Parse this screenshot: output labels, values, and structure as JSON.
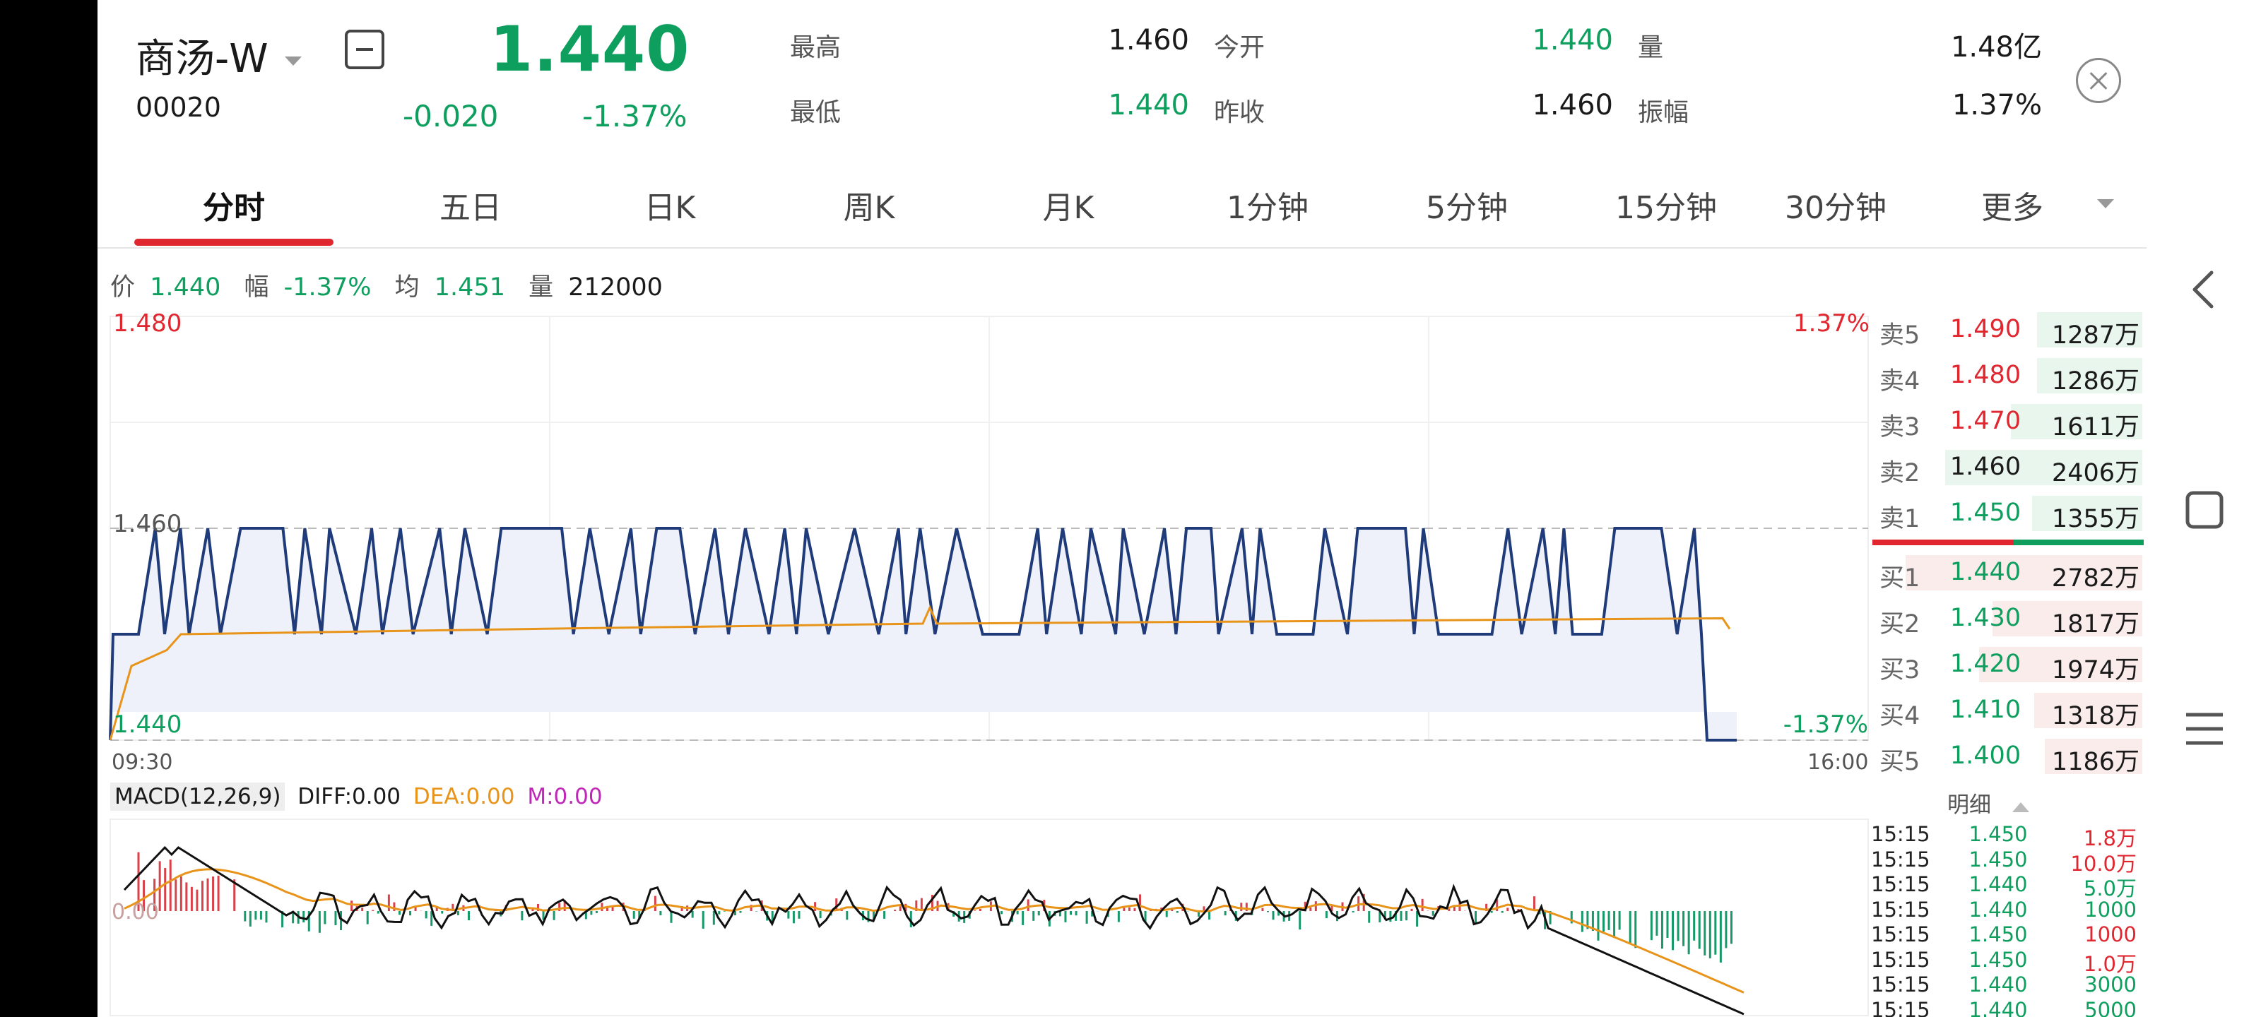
{
  "header": {
    "name": "商汤-W",
    "code": "00020",
    "price": "1.440",
    "change": "-0.020",
    "change_pct": "-1.37%",
    "quote": [
      {
        "label": "最高",
        "value": "1.460",
        "color": "#1a1a1a"
      },
      {
        "label": "今开",
        "value": "1.440",
        "color": "#0e9f5f"
      },
      {
        "label": "量",
        "value": "1.48亿",
        "color": "#1a1a1a"
      },
      {
        "label": "最低",
        "value": "1.440",
        "color": "#0e9f5f"
      },
      {
        "label": "昨收",
        "value": "1.460",
        "color": "#1a1a1a"
      },
      {
        "label": "振幅",
        "value": "1.37%",
        "color": "#1a1a1a"
      }
    ]
  },
  "tabs": [
    "分时",
    "五日",
    "日K",
    "周K",
    "月K",
    "1分钟",
    "5分钟",
    "15分钟",
    "30分钟",
    "更多"
  ],
  "info": {
    "price_label": "价",
    "price": "1.440",
    "amp_label": "幅",
    "amp": "-1.37%",
    "avg_label": "均",
    "avg": "1.451",
    "vol_label": "量",
    "vol": "212000"
  },
  "chart": {
    "y_top": "1.480",
    "y_mid": "1.460",
    "y_bottom": "1.440",
    "pct_top": "1.37%",
    "pct_bottom": "-1.37%",
    "x_start": "09:30",
    "x_end": "16:00",
    "price_range": [
      1.44,
      1.48
    ],
    "prev_close": 1.46
  },
  "chart_data": {
    "type": "line",
    "title": "",
    "xlabel": "",
    "ylabel": "",
    "x_range": [
      "09:30",
      "16:00"
    ],
    "ylim": [
      1.44,
      1.48
    ],
    "series": [
      {
        "name": "价",
        "style": "toggling",
        "low": 1.45,
        "high": 1.46,
        "final": 1.44,
        "color": "#1f3b7a"
      },
      {
        "name": "均",
        "values_summary": {
          "start": 1.44,
          "settle": 1.451
        },
        "color": "#e8941a"
      }
    ]
  },
  "macd": {
    "label": "MACD(12,26,9)",
    "diff": "DIFF:0.00",
    "dea": "DEA:0.00",
    "m": "M:0.00",
    "zero": "0.00"
  },
  "orderbook": {
    "asks": [
      {
        "label": "卖5",
        "price": "1.490",
        "vol": "1287万",
        "price_color": "#e0262f",
        "bar": 0.4
      },
      {
        "label": "卖4",
        "price": "1.480",
        "vol": "1286万",
        "price_color": "#e0262f",
        "bar": 0.4
      },
      {
        "label": "卖3",
        "price": "1.470",
        "vol": "1611万",
        "price_color": "#e0262f",
        "bar": 0.5
      },
      {
        "label": "卖2",
        "price": "1.460",
        "vol": "2406万",
        "price_color": "#1a1a1a",
        "bar": 0.75
      },
      {
        "label": "卖1",
        "price": "1.450",
        "vol": "1355万",
        "price_color": "#0e9f5f",
        "bar": 0.42
      }
    ],
    "bids": [
      {
        "label": "买1",
        "price": "1.440",
        "vol": "2782万",
        "price_color": "#0e9f5f",
        "bar": 0.9
      },
      {
        "label": "买2",
        "price": "1.430",
        "vol": "1817万",
        "price_color": "#0e9f5f",
        "bar": 0.57
      },
      {
        "label": "买3",
        "price": "1.420",
        "vol": "1974万",
        "price_color": "#0e9f5f",
        "bar": 0.62
      },
      {
        "label": "买4",
        "price": "1.410",
        "vol": "1318万",
        "price_color": "#0e9f5f",
        "bar": 0.41
      },
      {
        "label": "买5",
        "price": "1.400",
        "vol": "1186万",
        "price_color": "#0e9f5f",
        "bar": 0.37
      }
    ],
    "detail_label": "明细"
  },
  "trades": [
    {
      "time": "15:15",
      "price": "1.450",
      "vol": "1.8万",
      "color": "#e0262f"
    },
    {
      "time": "15:15",
      "price": "1.450",
      "vol": "10.0万",
      "color": "#e0262f"
    },
    {
      "time": "15:15",
      "price": "1.440",
      "vol": "5.0万",
      "color": "#0e9f5f"
    },
    {
      "time": "15:15",
      "price": "1.440",
      "vol": "1000",
      "color": "#0e9f5f"
    },
    {
      "time": "15:15",
      "price": "1.450",
      "vol": "1000",
      "color": "#e0262f"
    },
    {
      "time": "15:15",
      "price": "1.450",
      "vol": "1.0万",
      "color": "#e0262f"
    },
    {
      "time": "15:15",
      "price": "1.440",
      "vol": "3000",
      "color": "#0e9f5f"
    },
    {
      "time": "15:15",
      "price": "1.440",
      "vol": "5000",
      "color": "#0e9f5f"
    }
  ],
  "icons": {
    "collapse": "collapse-icon",
    "close": "close-icon",
    "back": "back-icon",
    "home": "home-icon",
    "menu": "menu-icon"
  }
}
